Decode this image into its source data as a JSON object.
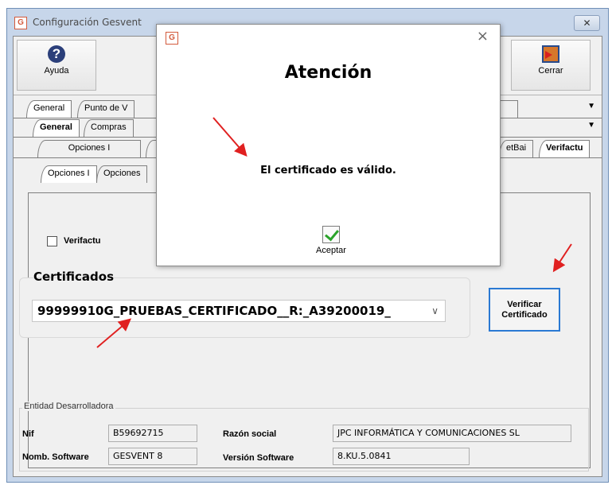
{
  "window": {
    "title": "Configuración Gesvent",
    "close_glyph": "✕",
    "logo_text": "G"
  },
  "toolbar": {
    "help_label": "Ayuda",
    "close_label": "Cerrar"
  },
  "tabs": {
    "row1": [
      "General",
      "Punto de V"
    ],
    "row2": [
      "General",
      "Compras"
    ],
    "row3": [
      "Opciones I",
      "etBai",
      "Verifactu"
    ],
    "row4": [
      "Opciones I",
      "Opciones"
    ]
  },
  "content": {
    "verifactu_label": "Verifactu",
    "verifactu_checked": false,
    "certificados_label": "Certificados",
    "certificate_selected": "99999910G_PRUEBAS_CERTIFICADO__R:_A39200019_",
    "verify_button_line1": "Verificar",
    "verify_button_line2": "Certificado"
  },
  "entidad": {
    "legend": "Entidad Desarrolladora",
    "nif_label": "Nif",
    "nif_value": "B59692715",
    "razon_label": "Razón social",
    "razon_value": "JPC INFORMÁTICA Y COMUNICACIONES SL",
    "software_label": "Nomb. Software",
    "software_value": "GESVENT 8",
    "version_label": "Versión Software",
    "version_value": "8.KU.5.0841"
  },
  "dialog": {
    "title": "Atención",
    "message": "El certificado es válido.",
    "accept_label": "Aceptar",
    "close_glyph": "×"
  },
  "colors": {
    "window_frame": "#c7d6ea",
    "verify_border": "#2a79d3",
    "annotation_arrow": "#e02020",
    "check_green": "#2aa32a"
  }
}
